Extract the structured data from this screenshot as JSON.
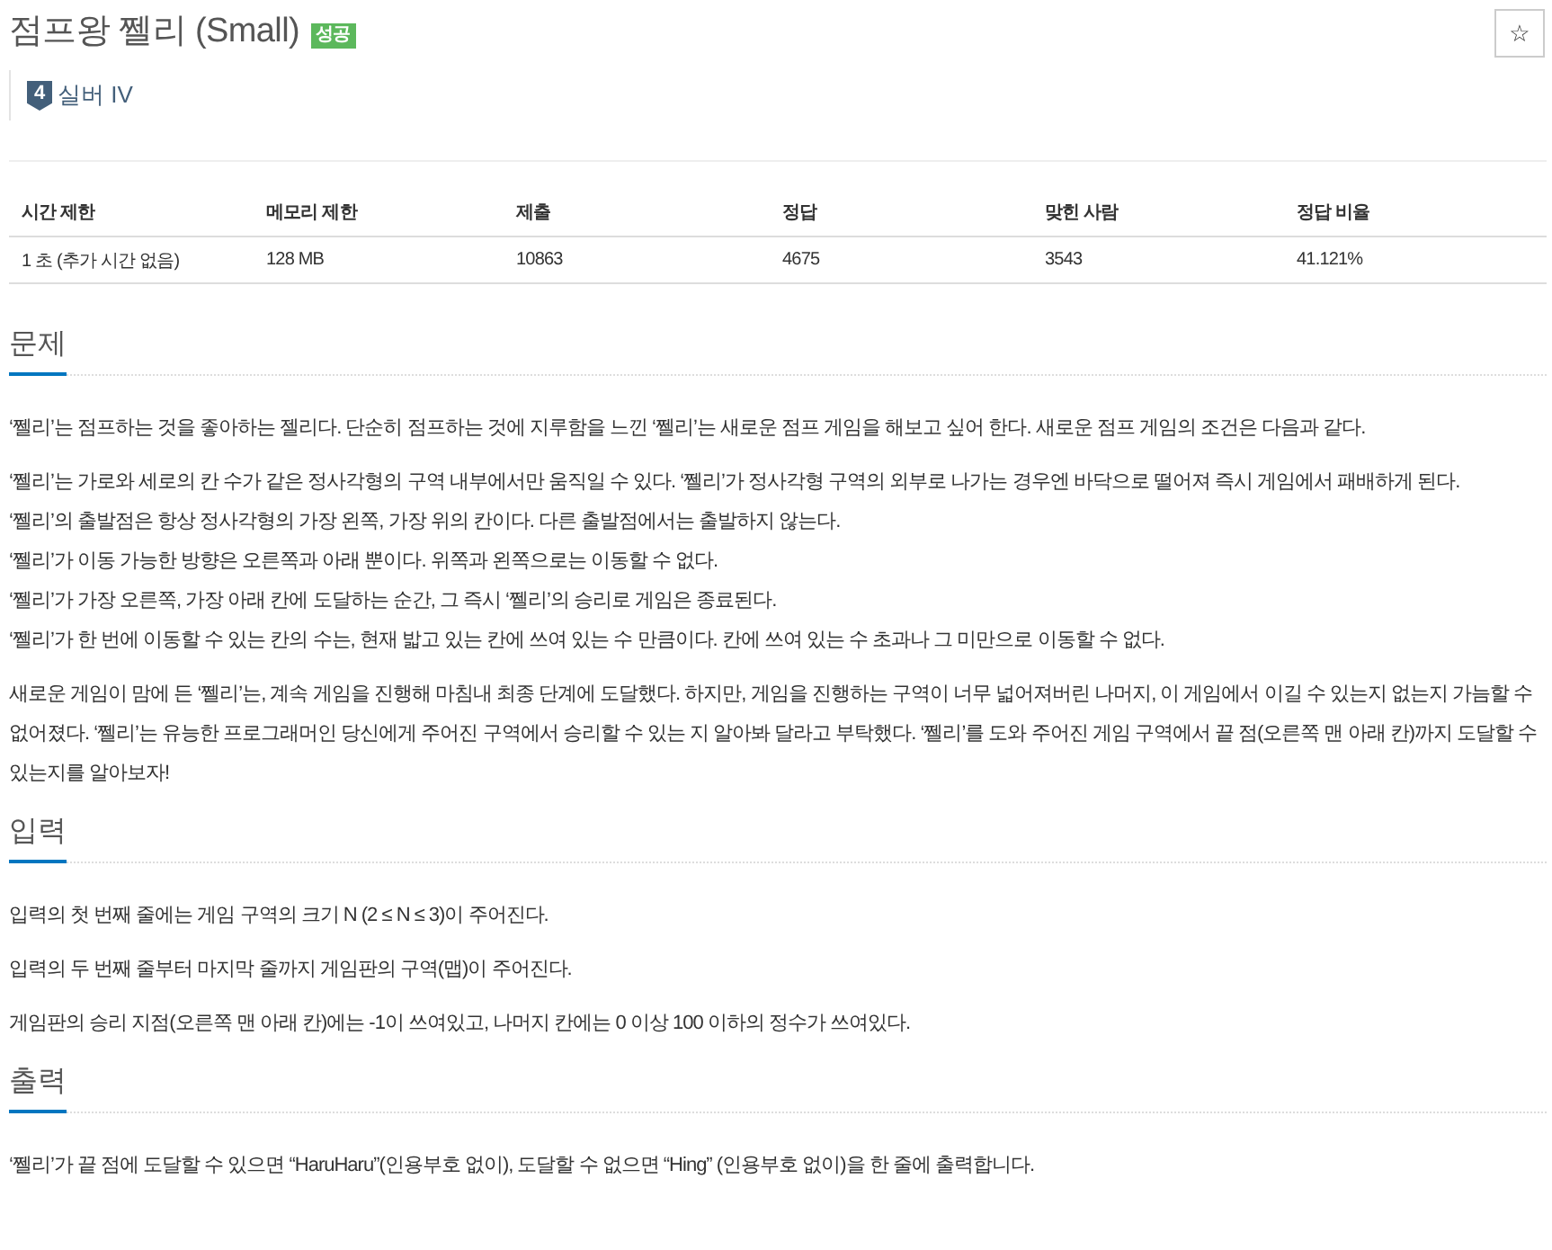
{
  "problem": {
    "title": "점프왕 쩰리 (Small)",
    "status_badge": "성공",
    "favorite_button": "☆",
    "tier": {
      "number": "4",
      "label": "실버 IV"
    }
  },
  "info_table": {
    "columns": [
      "시간 제한",
      "메모리 제한",
      "제출",
      "정답",
      "맞힌 사람",
      "정답 비율"
    ],
    "rows": [
      [
        "1 초 (추가 시간 없음)",
        "128 MB",
        "10863",
        "4675",
        "3543",
        "41.121%"
      ]
    ]
  },
  "sections": [
    {
      "heading": "문제",
      "paragraphs": [
        {
          "lines": [
            "‘쩰리’는 점프하는 것을 좋아하는 젤리다. 단순히 점프하는 것에 지루함을 느낀 ‘쩰리’는 새로운 점프 게임을 해보고 싶어 한다. 새로운 점프 게임의 조건은 다음과 같다."
          ]
        },
        {
          "lines": [
            "‘쩰리’는 가로와 세로의 칸 수가 같은 정사각형의 구역 내부에서만 움직일 수 있다. ‘쩰리’가 정사각형 구역의 외부로 나가는 경우엔 바닥으로 떨어져 즉시 게임에서 패배하게 된다.",
            "‘쩰리’의 출발점은 항상 정사각형의 가장 왼쪽, 가장 위의 칸이다. 다른 출발점에서는 출발하지 않는다.",
            "‘쩰리’가 이동 가능한 방향은 오른쪽과 아래 뿐이다. 위쪽과 왼쪽으로는 이동할 수 없다.",
            "‘쩰리’가 가장 오른쪽, 가장 아래 칸에 도달하는 순간, 그 즉시 ‘쩰리’의 승리로 게임은 종료된다.",
            "‘쩰리’가 한 번에 이동할 수 있는 칸의 수는, 현재 밟고 있는 칸에 쓰여 있는 수 만큼이다. 칸에 쓰여 있는 수 초과나 그 미만으로 이동할 수 없다."
          ]
        },
        {
          "lines": [
            "새로운 게임이 맘에 든 ‘쩰리’는, 계속 게임을 진행해 마침내 최종 단계에 도달했다. 하지만, 게임을 진행하는 구역이 너무 넓어져버린 나머지, 이 게임에서 이길 수 있는지 없는지 가늠할 수 없어졌다. ‘쩰리’는 유능한 프로그래머인 당신에게 주어진 구역에서 승리할 수 있는 지 알아봐 달라고 부탁했다. ‘쩰리’를 도와 주어진 게임 구역에서 끝 점(오른쪽 맨 아래 칸)까지 도달할 수 있는지를 알아보자!"
          ]
        }
      ]
    },
    {
      "heading": "입력",
      "paragraphs": [
        {
          "lines": [
            "입력의 첫 번째 줄에는 게임 구역의 크기 N (2 ≤ N ≤ 3)이 주어진다."
          ]
        },
        {
          "lines": [
            "입력의 두 번째 줄부터 마지막 줄까지 게임판의 구역(맵)이 주어진다."
          ]
        },
        {
          "lines": [
            "게임판의 승리 지점(오른쪽 맨 아래 칸)에는 -1이 쓰여있고, 나머지 칸에는 0 이상 100 이하의 정수가 쓰여있다."
          ]
        }
      ]
    },
    {
      "heading": "출력",
      "paragraphs": [
        {
          "lines": [
            "‘쩰리’가 끝 점에 도달할 수 있으면 “HaruHaru”(인용부호 없이), 도달할 수 없으면 “Hing” (인용부호 없이)을 한 줄에 출력합니다."
          ]
        }
      ]
    }
  ]
}
